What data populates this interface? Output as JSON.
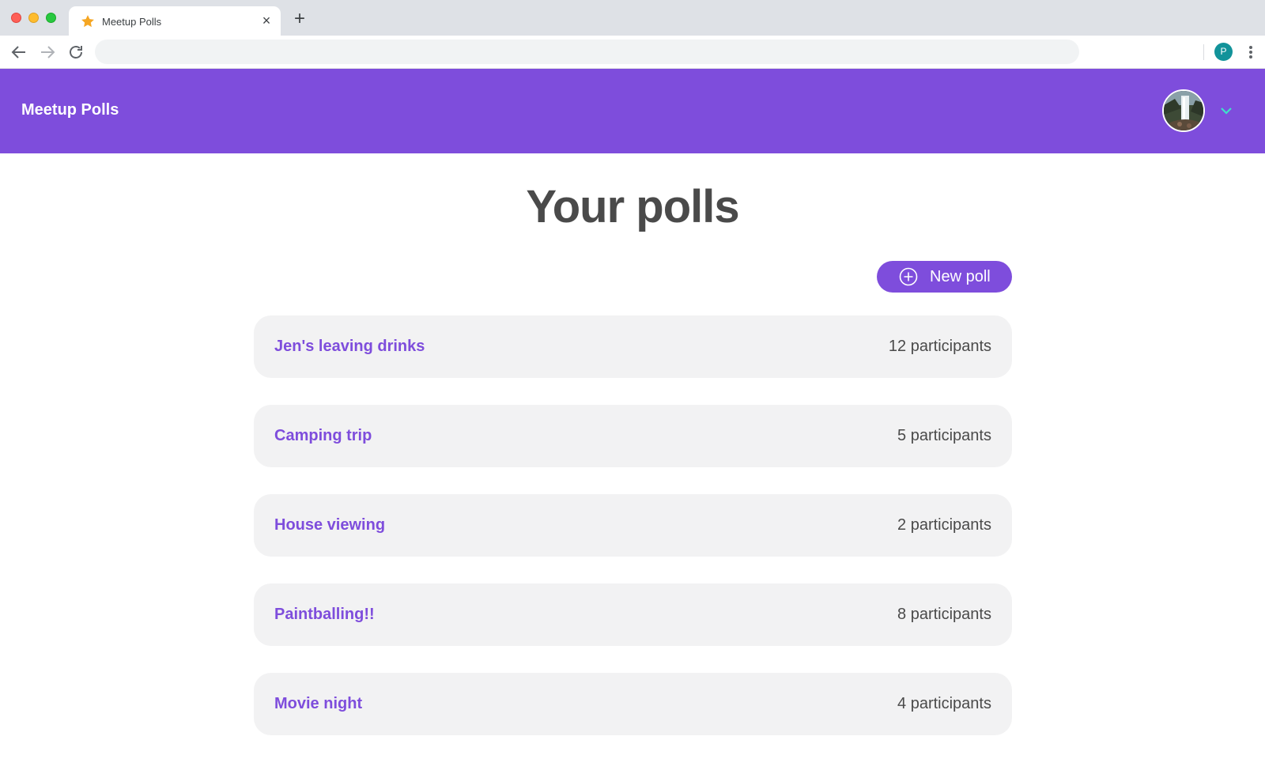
{
  "browser": {
    "tab_title": "Meetup Polls",
    "tab_favicon": "star-icon",
    "address_value": "",
    "profile_initial": "P"
  },
  "app": {
    "brand": "Meetup Polls",
    "accent_color": "#7e4ddc",
    "chevron_color": "#3ee0c9"
  },
  "main": {
    "title": "Your polls",
    "new_poll_label": "New poll",
    "polls": [
      {
        "name": "Jen's leaving drinks",
        "participants": "12 participants"
      },
      {
        "name": "Camping trip",
        "participants": "5 participants"
      },
      {
        "name": "House viewing",
        "participants": "2 participants"
      },
      {
        "name": "Paintballing!!",
        "participants": "8 participants"
      },
      {
        "name": "Movie night",
        "participants": "4 participants"
      }
    ]
  }
}
